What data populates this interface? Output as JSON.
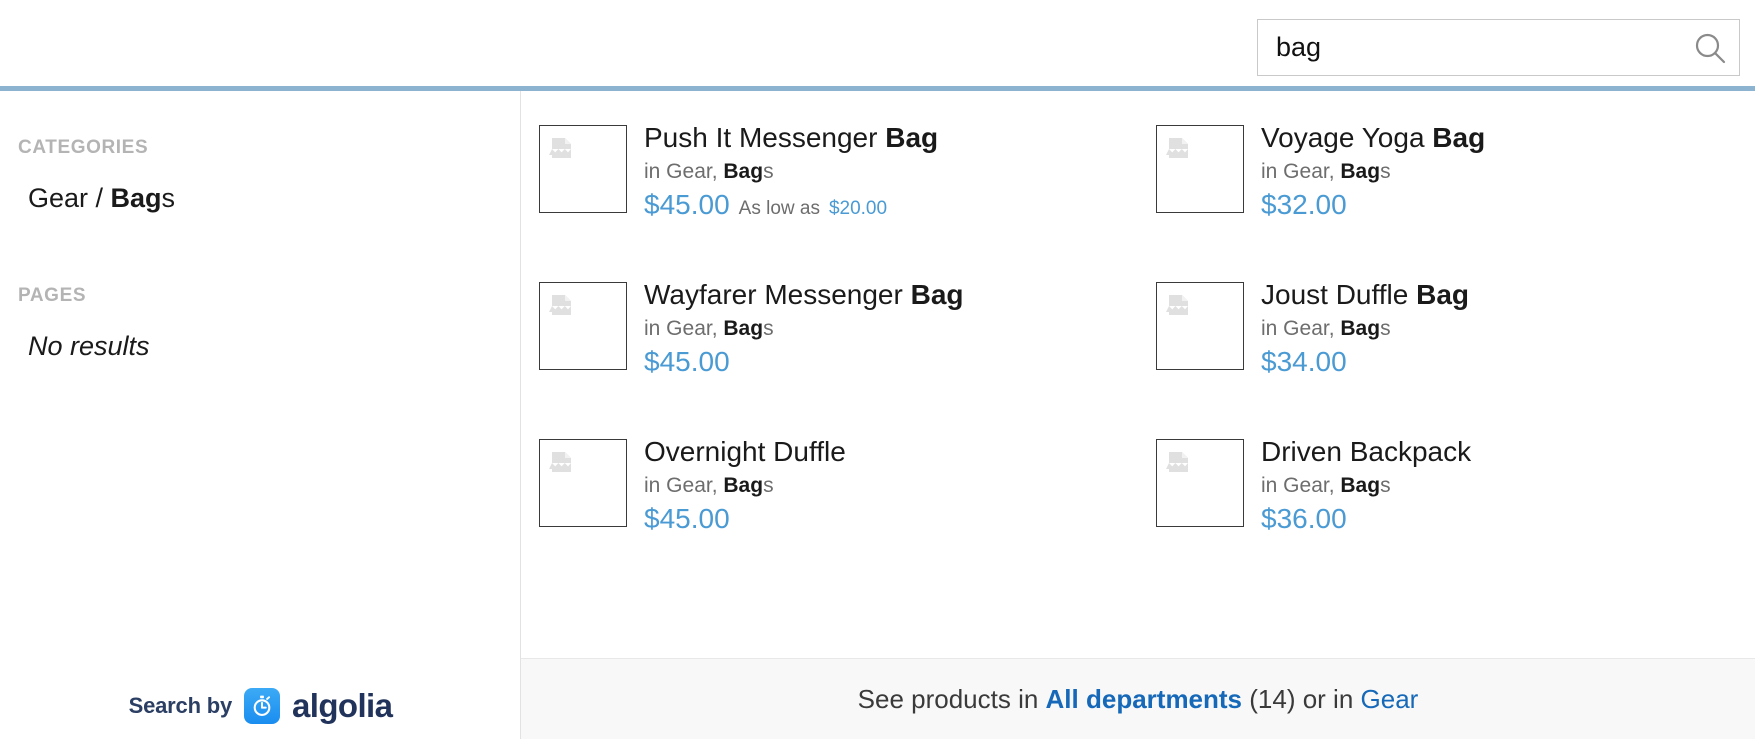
{
  "search": {
    "value": "bag",
    "placeholder": "Search...",
    "icon": "search-icon"
  },
  "sidebar": {
    "categories_title": "CATEGORIES",
    "categories": [
      {
        "prefix": "Gear / ",
        "highlight": "Bag",
        "suffix": "s"
      }
    ],
    "pages_title": "PAGES",
    "pages_empty": "No results",
    "branding": {
      "by_label": "Search by",
      "name": "algolia",
      "mark_icon": "algolia-stopwatch-icon",
      "mark_color": "#1a8df0",
      "text_color": "#21335b"
    }
  },
  "results": {
    "thumb_icon": "broken-image-icon",
    "items": [
      {
        "name_prefix": "Push It Messenger ",
        "name_highlight": "Bag",
        "name_suffix": "",
        "cat_prefix": "in Gear, ",
        "cat_highlight": "Bag",
        "cat_suffix": "s",
        "price": "$45.00",
        "as_low_as_label": "As low as",
        "as_low_as_price": "$20.00"
      },
      {
        "name_prefix": "Voyage Yoga ",
        "name_highlight": "Bag",
        "name_suffix": "",
        "cat_prefix": "in Gear, ",
        "cat_highlight": "Bag",
        "cat_suffix": "s",
        "price": "$32.00",
        "as_low_as_label": "",
        "as_low_as_price": ""
      },
      {
        "name_prefix": "Wayfarer Messenger ",
        "name_highlight": "Bag",
        "name_suffix": "",
        "cat_prefix": "in Gear, ",
        "cat_highlight": "Bag",
        "cat_suffix": "s",
        "price": "$45.00",
        "as_low_as_label": "",
        "as_low_as_price": ""
      },
      {
        "name_prefix": "Joust Duffle ",
        "name_highlight": "Bag",
        "name_suffix": "",
        "cat_prefix": "in Gear, ",
        "cat_highlight": "Bag",
        "cat_suffix": "s",
        "price": "$34.00",
        "as_low_as_label": "",
        "as_low_as_price": ""
      },
      {
        "name_prefix": "Overnight Duffle",
        "name_highlight": "",
        "name_suffix": "",
        "cat_prefix": "in Gear, ",
        "cat_highlight": "Bag",
        "cat_suffix": "s",
        "price": "$45.00",
        "as_low_as_label": "",
        "as_low_as_price": ""
      },
      {
        "name_prefix": "Driven Backpack",
        "name_highlight": "",
        "name_suffix": "",
        "cat_prefix": "in Gear, ",
        "cat_highlight": "Bag",
        "cat_suffix": "s",
        "price": "$36.00",
        "as_low_as_label": "",
        "as_low_as_price": ""
      }
    ]
  },
  "footer": {
    "lead": "See products in ",
    "all_departments": "All departments",
    "count": " (14) or in ",
    "department": "Gear"
  },
  "colors": {
    "accent_blue": "#4a9ad4",
    "link_blue": "#1668b8",
    "rule_blue": "#8cb3cf",
    "muted": "#b4b4b4"
  }
}
